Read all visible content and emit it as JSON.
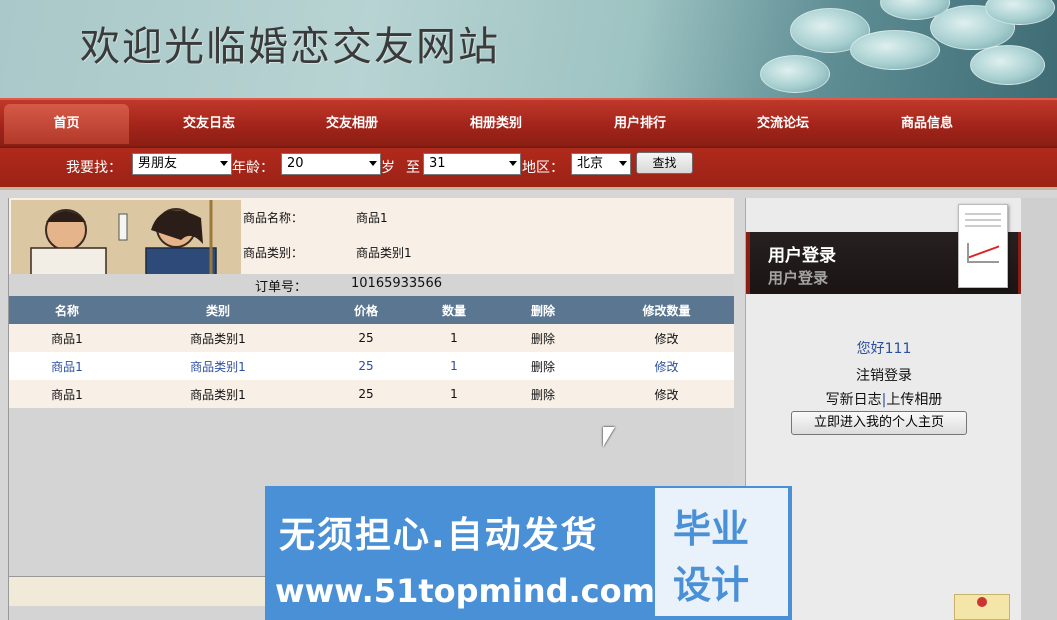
{
  "banner": {
    "title": "欢迎光临婚恋交友网站"
  },
  "nav": {
    "items": [
      "首页",
      "交友日志",
      "交友相册",
      "相册类别",
      "用户排行",
      "交流论坛",
      "商品信息"
    ]
  },
  "search": {
    "find_label": "我要找：",
    "gender_value": "男朋友",
    "age_label": "年龄：",
    "age_from": "20",
    "age_unit": "岁",
    "to_label": "至",
    "age_to": "31",
    "region_label": "地区：",
    "region_value": "北京",
    "button": "查找"
  },
  "product": {
    "name_label": "商品名称：",
    "name_value": "商品1",
    "category_label": "商品类别：",
    "category_value": "商品类别1",
    "order_label": "订单号：",
    "order_value": "10165933566"
  },
  "table": {
    "headers": [
      "名称",
      "类别",
      "价格",
      "数量",
      "删除",
      "修改数量"
    ],
    "rows": [
      [
        "商品1",
        "商品类别1",
        "25",
        "1",
        "删除",
        "修改"
      ],
      [
        "商品1",
        "商品类别1",
        "25",
        "1",
        "删除",
        "修改"
      ],
      [
        "商品1",
        "商品类别1",
        "25",
        "1",
        "删除",
        "修改"
      ]
    ]
  },
  "sidebar": {
    "login_title": "用户登录",
    "greeting": "您好111",
    "logout": "注销登录",
    "write_log": "写新日志",
    "separator": "|",
    "upload_album": "上传相册",
    "home_button": "立即进入我的个人主页"
  },
  "ad": {
    "slogan": "无须担心.自动发货",
    "url": "www.51topmind.com",
    "box_line1": "毕业",
    "box_line2": "设计"
  },
  "colors": {
    "nav_red": "#a3241a",
    "table_header": "#5b7690",
    "link_blue": "#2b4fa0",
    "ad_blue": "#4a90d6"
  }
}
